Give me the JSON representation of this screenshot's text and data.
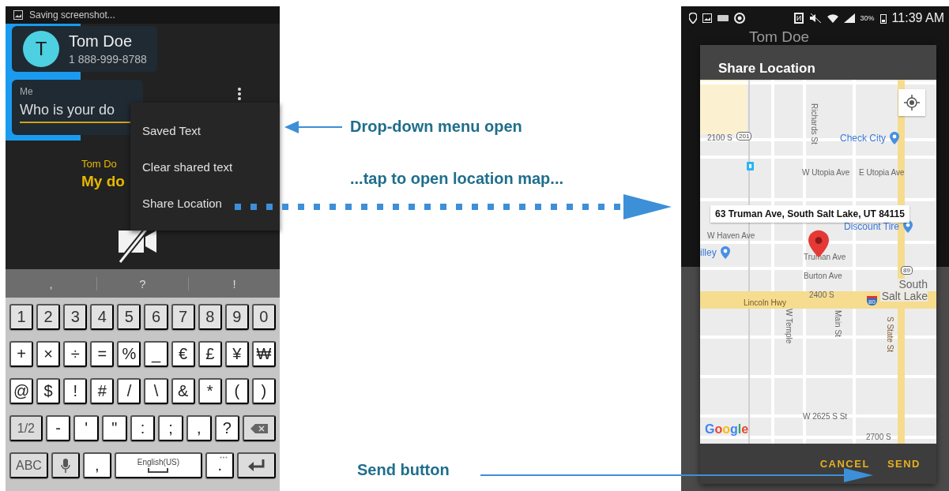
{
  "left_phone": {
    "status_text": "Saving screenshot...",
    "contact": {
      "initial": "T",
      "name": "Tom Doe",
      "phone": "1 888-999-8788"
    },
    "message": {
      "sender": "Me",
      "text": "Who is your do"
    },
    "menu": [
      {
        "label": "Saved Text"
      },
      {
        "label": "Clear shared text"
      },
      {
        "label": "Share Location"
      }
    ],
    "reply": {
      "sender": "Tom Do",
      "text": "My do"
    },
    "suggestions": [
      ",",
      "?",
      "!"
    ],
    "keyboard": [
      [
        {
          "kind": "digit",
          "label": "1"
        },
        {
          "kind": "digit",
          "label": "2"
        },
        {
          "kind": "digit",
          "label": "3"
        },
        {
          "kind": "digit",
          "label": "4"
        },
        {
          "kind": "digit",
          "label": "5"
        },
        {
          "kind": "digit",
          "label": "6"
        },
        {
          "kind": "digit",
          "label": "7"
        },
        {
          "kind": "digit",
          "label": "8"
        },
        {
          "kind": "digit",
          "label": "9"
        },
        {
          "kind": "digit",
          "label": "0"
        }
      ],
      [
        {
          "kind": "symbol",
          "label": "+"
        },
        {
          "kind": "symbol",
          "label": "×"
        },
        {
          "kind": "symbol",
          "label": "÷"
        },
        {
          "kind": "symbol",
          "label": "="
        },
        {
          "kind": "symbol",
          "label": "%"
        },
        {
          "kind": "symbol",
          "label": "_"
        },
        {
          "kind": "symbol",
          "label": "€"
        },
        {
          "kind": "symbol",
          "label": "£"
        },
        {
          "kind": "symbol",
          "label": "¥"
        },
        {
          "kind": "symbol",
          "label": "₩"
        }
      ],
      [
        {
          "kind": "symbol",
          "label": "@"
        },
        {
          "kind": "symbol",
          "label": "$"
        },
        {
          "kind": "symbol",
          "label": "!"
        },
        {
          "kind": "symbol",
          "label": "#"
        },
        {
          "kind": "symbol",
          "label": "/"
        },
        {
          "kind": "symbol",
          "label": "\\"
        },
        {
          "kind": "symbol",
          "label": "&"
        },
        {
          "kind": "symbol",
          "label": "*"
        },
        {
          "kind": "symbol",
          "label": "("
        },
        {
          "kind": "symbol",
          "label": ")"
        }
      ],
      [
        {
          "kind": "function",
          "label": "1/2"
        },
        {
          "kind": "symbol",
          "label": "-"
        },
        {
          "kind": "symbol",
          "label": "'"
        },
        {
          "kind": "symbol",
          "label": "\""
        },
        {
          "kind": "symbol",
          "label": ":"
        },
        {
          "kind": "symbol",
          "label": ";"
        },
        {
          "kind": "symbol",
          "label": ","
        },
        {
          "kind": "symbol",
          "label": "?"
        },
        {
          "kind": "backspace"
        }
      ],
      [
        {
          "kind": "function",
          "label": "ABC"
        },
        {
          "kind": "mic"
        },
        {
          "kind": "symbol",
          "label": ","
        },
        {
          "kind": "space",
          "label": "English(US)"
        },
        {
          "kind": "more",
          "label": "."
        },
        {
          "kind": "enter"
        }
      ]
    ]
  },
  "right_phone": {
    "battery": "30%",
    "time": "11:39 AM",
    "background_contact": "Tom Doe",
    "dialog": {
      "title": "Share Location",
      "map_labels": [
        {
          "kind": "street-vertical",
          "text": "Richards St"
        },
        {
          "kind": "street",
          "text": "2100 S"
        },
        {
          "kind": "shield",
          "text": "201"
        },
        {
          "kind": "place",
          "text": "Check City"
        },
        {
          "kind": "street",
          "text": "W Utopia Ave"
        },
        {
          "kind": "street",
          "text": "E Utopia Ave"
        },
        {
          "kind": "place",
          "text": "Discount Tire"
        },
        {
          "kind": "street",
          "text": "W Haven Ave"
        },
        {
          "kind": "place",
          "text": "illey"
        },
        {
          "kind": "street",
          "text": "Truman Ave"
        },
        {
          "kind": "shield",
          "text": "89"
        },
        {
          "kind": "street",
          "text": "Burton Ave"
        },
        {
          "kind": "street",
          "text": "2400 S"
        },
        {
          "kind": "area",
          "text": "South Salt Lake"
        },
        {
          "kind": "highway",
          "text": "Lincoln Hwy"
        },
        {
          "kind": "interstate",
          "text": "80"
        },
        {
          "kind": "street-vertical",
          "text": "W Temple"
        },
        {
          "kind": "street-vertical",
          "text": "Main St"
        },
        {
          "kind": "highway-vertical",
          "text": "S State St"
        },
        {
          "kind": "street",
          "text": "W 2625 S St"
        },
        {
          "kind": "street",
          "text": "2700 S"
        }
      ],
      "address": "63 Truman Ave, South Salt Lake, UT 84115",
      "attribution": "Google",
      "buttons": [
        "CANCEL",
        "SEND"
      ]
    }
  },
  "annotations": [
    {
      "kind": "menu",
      "text": "Drop-down menu open"
    },
    {
      "kind": "map",
      "text": "...tap to open location map..."
    },
    {
      "kind": "send",
      "text": "Send button"
    }
  ]
}
